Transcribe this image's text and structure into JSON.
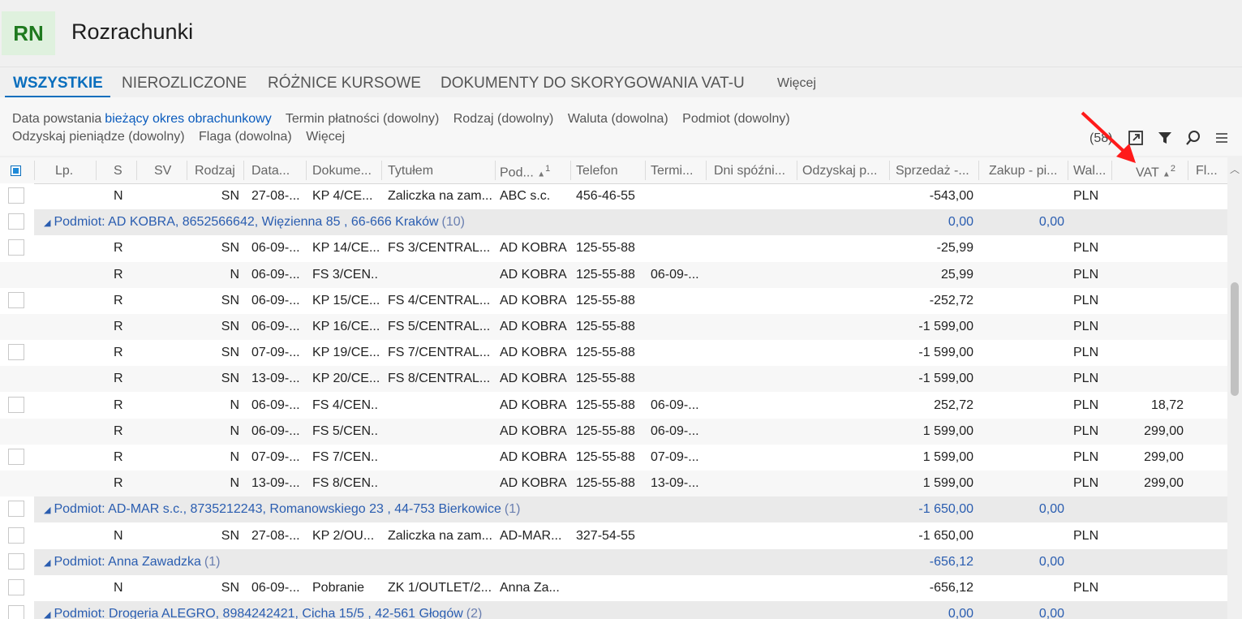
{
  "app": {
    "logo": "RN",
    "title": "Rozrachunki"
  },
  "tabs": [
    "WSZYSTKIE",
    "NIEROZLICZONE",
    "RÓŻNICE KURSOWE",
    "DOKUMENTY DO SKORYGOWANIA VAT-U",
    "Więcej"
  ],
  "filters": {
    "row1": [
      {
        "label": "Data powstania",
        "value": "bieżący okres obrachunkowy"
      },
      {
        "label": "Termin płatności (dowolny)"
      },
      {
        "label": "Rodzaj (dowolny)"
      },
      {
        "label": "Waluta (dowolna)"
      },
      {
        "label": "Podmiot (dowolny)"
      }
    ],
    "row2": [
      "Odzyskaj pieniądze (dowolny)",
      "Flaga (dowolna)",
      "Więcej"
    ]
  },
  "toolbar": {
    "count": "(58)"
  },
  "columns": [
    "Lp.",
    "S",
    "SV",
    "Rodzaj",
    "Data...",
    "Dokume...",
    "Tytułem",
    "Pod...",
    "Telefon",
    "Termi...",
    "Dni spóźni...",
    "Odzyskaj p...",
    "Sprzedaż -...",
    "Zakup - pi...",
    "Wal...",
    "VAT",
    "Fl..."
  ],
  "sort": {
    "pod": "1",
    "vat": "2"
  },
  "rows": [
    {
      "kind": "data",
      "s": "N",
      "rodzaj": "SN",
      "data": "27-08-...",
      "dok": "KP 4/CE...",
      "tyt": "Zaliczka na zam...",
      "pod": "ABC s.c.",
      "tel": "456-46-55",
      "term": "",
      "sprz": "-543,00",
      "wal": "PLN",
      "vat": ""
    },
    {
      "kind": "group",
      "label": "Podmiot: AD KOBRA, 8652566642, Więzienna  85 , 66-666 Kraków",
      "count": "(10)",
      "sprz": "0,00",
      "zak": "0,00"
    },
    {
      "kind": "data",
      "s": "R",
      "rodzaj": "SN",
      "data": "06-09-...",
      "dok": "KP 14/CE...",
      "tyt": "FS 3/CENTRAL...",
      "pod": "AD KOBRA",
      "tel": "125-55-88",
      "term": "",
      "sprz": "-25,99",
      "wal": "PLN",
      "vat": ""
    },
    {
      "kind": "data",
      "s": "R",
      "rodzaj": "N",
      "data": "06-09-...",
      "dok": "FS 3/CEN...",
      "tyt": "",
      "pod": "AD KOBRA",
      "tel": "125-55-88",
      "term": "06-09-...",
      "sprz": "25,99",
      "wal": "PLN",
      "vat": ""
    },
    {
      "kind": "data",
      "s": "R",
      "rodzaj": "SN",
      "data": "06-09-...",
      "dok": "KP 15/CE...",
      "tyt": "FS 4/CENTRAL...",
      "pod": "AD KOBRA",
      "tel": "125-55-88",
      "term": "",
      "sprz": "-252,72",
      "wal": "PLN",
      "vat": ""
    },
    {
      "kind": "data",
      "s": "R",
      "rodzaj": "SN",
      "data": "06-09-...",
      "dok": "KP 16/CE...",
      "tyt": "FS 5/CENTRAL...",
      "pod": "AD KOBRA",
      "tel": "125-55-88",
      "term": "",
      "sprz": "-1 599,00",
      "wal": "PLN",
      "vat": ""
    },
    {
      "kind": "data",
      "s": "R",
      "rodzaj": "SN",
      "data": "07-09-...",
      "dok": "KP 19/CE...",
      "tyt": "FS 7/CENTRAL...",
      "pod": "AD KOBRA",
      "tel": "125-55-88",
      "term": "",
      "sprz": "-1 599,00",
      "wal": "PLN",
      "vat": ""
    },
    {
      "kind": "data",
      "s": "R",
      "rodzaj": "SN",
      "data": "13-09-...",
      "dok": "KP 20/CE...",
      "tyt": "FS 8/CENTRAL...",
      "pod": "AD KOBRA",
      "tel": "125-55-88",
      "term": "",
      "sprz": "-1 599,00",
      "wal": "PLN",
      "vat": ""
    },
    {
      "kind": "data",
      "s": "R",
      "rodzaj": "N",
      "data": "06-09-...",
      "dok": "FS 4/CEN...",
      "tyt": "",
      "pod": "AD KOBRA",
      "tel": "125-55-88",
      "term": "06-09-...",
      "sprz": "252,72",
      "wal": "PLN",
      "vat": "18,72"
    },
    {
      "kind": "data",
      "s": "R",
      "rodzaj": "N",
      "data": "06-09-...",
      "dok": "FS 5/CEN...",
      "tyt": "",
      "pod": "AD KOBRA",
      "tel": "125-55-88",
      "term": "06-09-...",
      "sprz": "1 599,00",
      "wal": "PLN",
      "vat": "299,00"
    },
    {
      "kind": "data",
      "s": "R",
      "rodzaj": "N",
      "data": "07-09-...",
      "dok": "FS 7/CEN...",
      "tyt": "",
      "pod": "AD KOBRA",
      "tel": "125-55-88",
      "term": "07-09-...",
      "sprz": "1 599,00",
      "wal": "PLN",
      "vat": "299,00"
    },
    {
      "kind": "data",
      "s": "R",
      "rodzaj": "N",
      "data": "13-09-...",
      "dok": "FS 8/CEN...",
      "tyt": "",
      "pod": "AD KOBRA",
      "tel": "125-55-88",
      "term": "13-09-...",
      "sprz": "1 599,00",
      "wal": "PLN",
      "vat": "299,00"
    },
    {
      "kind": "group",
      "label": "Podmiot: AD-MAR s.c., 8735212243, Romanowskiego 23 , 44-753 Bierkowice",
      "count": "(1)",
      "sprz": "-1 650,00",
      "zak": "0,00"
    },
    {
      "kind": "data",
      "s": "N",
      "rodzaj": "SN",
      "data": "27-08-...",
      "dok": "KP 2/OU...",
      "tyt": "Zaliczka na zam...",
      "pod": "AD-MAR...",
      "tel": "327-54-55",
      "term": "",
      "sprz": "-1 650,00",
      "wal": "PLN",
      "vat": ""
    },
    {
      "kind": "group",
      "label": "Podmiot: Anna Zawadzka",
      "count": "(1)",
      "sprz": "-656,12",
      "zak": "0,00"
    },
    {
      "kind": "data",
      "s": "N",
      "rodzaj": "SN",
      "data": "06-09-...",
      "dok": "Pobranie",
      "tyt": "ZK 1/OUTLET/2...",
      "pod": "Anna Za...",
      "tel": "",
      "term": "",
      "sprz": "-656,12",
      "wal": "PLN",
      "vat": ""
    },
    {
      "kind": "group",
      "label": "Podmiot: Drogeria ALEGRO, 8984242421, Cicha  15/5 , 42-561 Głogów",
      "count": "(2)",
      "sprz": "0,00",
      "zak": "0,00"
    }
  ]
}
